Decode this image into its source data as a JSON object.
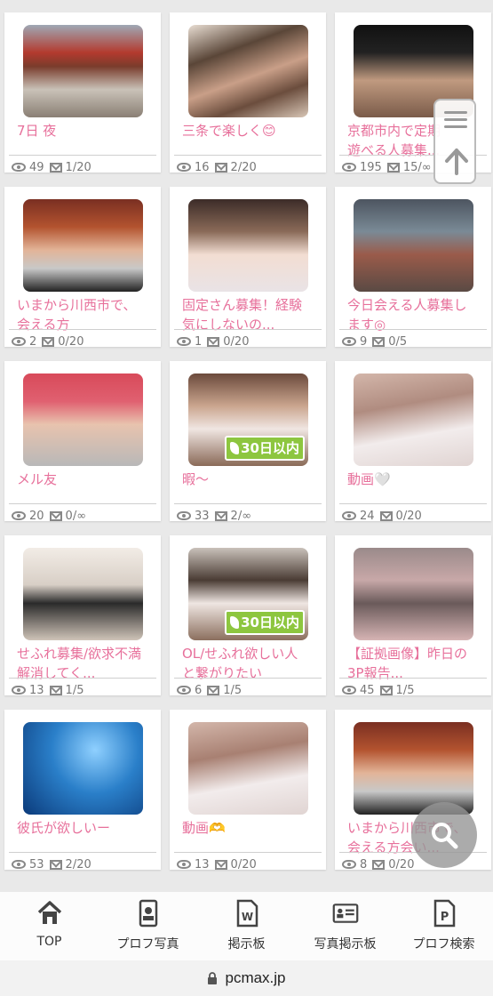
{
  "colors": {
    "title_pink": "#e7709b",
    "badge_green": "#8dc63f",
    "nav_text": "#333333"
  },
  "posts": [
    {
      "title": "7日 夜",
      "views": "49",
      "mail": "1/20",
      "badge": ""
    },
    {
      "title": "三条で楽しく😊",
      "views": "16",
      "mail": "2/20",
      "badge": ""
    },
    {
      "title": "京都市内で定期\n遊べる人募集...",
      "views": "195",
      "mail": "15/∞",
      "badge": ""
    },
    {
      "title": "いまから川西市で、\n会える方",
      "views": "2",
      "mail": "0/20",
      "badge": ""
    },
    {
      "title": "固定さん募集！経験\n気にしないの...",
      "views": "1",
      "mail": "0/20",
      "badge": ""
    },
    {
      "title": "今日会える人募集し\nます◎",
      "views": "9",
      "mail": "0/5",
      "badge": ""
    },
    {
      "title": "メル友",
      "views": "20",
      "mail": "0/∞",
      "badge": ""
    },
    {
      "title": "暇〜",
      "views": "33",
      "mail": "2/∞",
      "badge": "30日以内"
    },
    {
      "title": "動画🤍",
      "views": "24",
      "mail": "0/20",
      "badge": ""
    },
    {
      "title": "せふれ募集/欲求不満\n解消してく...",
      "views": "13",
      "mail": "1/5",
      "badge": ""
    },
    {
      "title": "OL/せふれ欲しい人\nと繋がりたい",
      "views": "6",
      "mail": "1/5",
      "badge": "30日以内"
    },
    {
      "title": "【証拠画像】昨日の\n3P報告...",
      "views": "45",
      "mail": "1/5",
      "badge": ""
    },
    {
      "title": "彼氏が欲しいー",
      "views": "53",
      "mail": "2/20",
      "badge": ""
    },
    {
      "title": "動画🫶",
      "views": "13",
      "mail": "0/20",
      "badge": ""
    },
    {
      "title": "いまから川西市で、\n会える方会い...",
      "views": "8",
      "mail": "0/20",
      "badge": ""
    }
  ],
  "nav": {
    "top": "TOP",
    "profile_photos": "プロフ写真",
    "board": "掲示板",
    "photo_board": "写真掲示板",
    "profile_search": "プロフ検索"
  },
  "url": "pcmax.jp",
  "icons": {
    "views": "eye-icon",
    "mail": "mail-icon",
    "menu": "hamburger-icon",
    "up": "arrow-up-icon",
    "search": "search-icon",
    "home": "home-icon",
    "lock": "lock-icon"
  }
}
